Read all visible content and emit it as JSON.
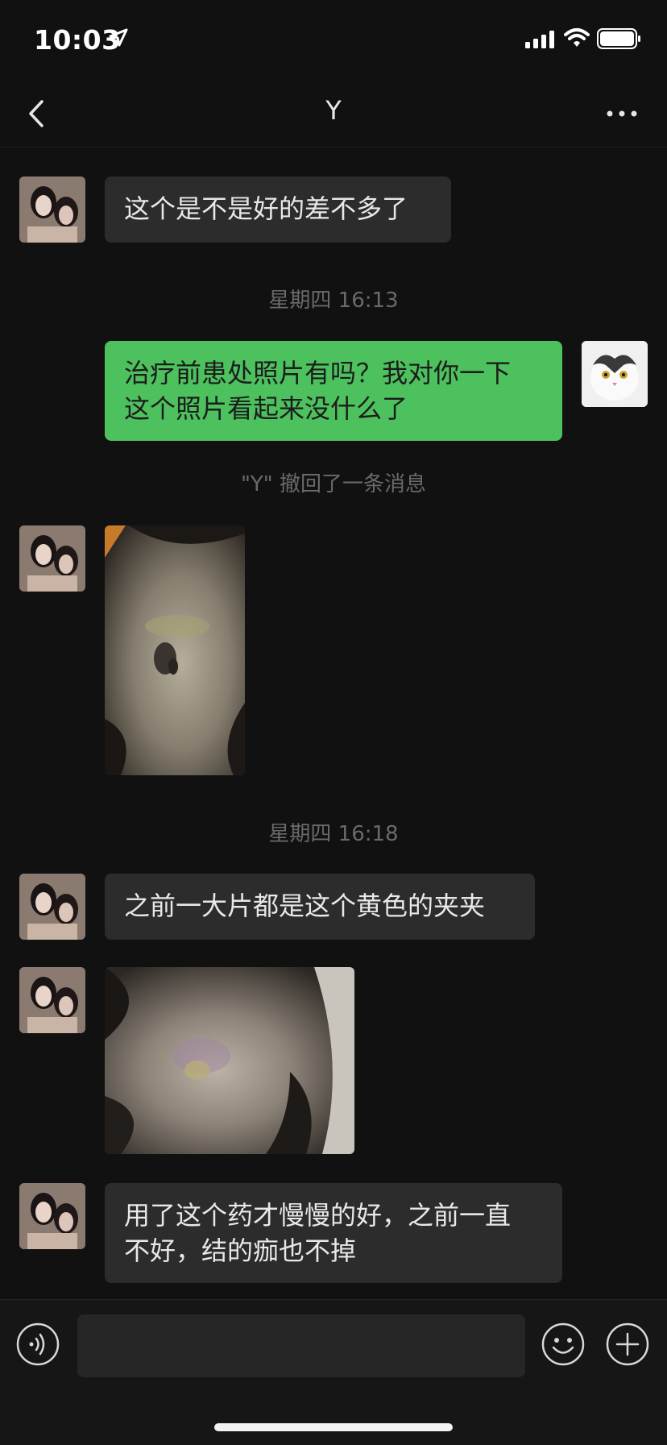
{
  "status_bar": {
    "time": "10:03"
  },
  "nav": {
    "title": "Y"
  },
  "messages": {
    "m1": "这个是不是好的差不多了",
    "t1": "星期四 16:13",
    "m2": "治疗前患处照片有吗？我对你一下\n 这个照片看起来没什么了",
    "recall": "\"Y\" 撤回了一条消息",
    "t2": "星期四 16:18",
    "m3": "之前一大片都是这个黄色的夹夹",
    "m4": "用了这个药才慢慢的好，之前一直\n不好，结的痂也不掉"
  },
  "icons": {
    "back": "chevron-left-icon",
    "more": "more-dots-icon",
    "voice": "voice-icon",
    "emoji": "emoji-icon",
    "plus": "plus-icon"
  },
  "colors": {
    "background": "#111111",
    "bubble_in": "#2c2c2c",
    "bubble_out": "#4cc15e",
    "timestamp": "#6a6a6a"
  }
}
